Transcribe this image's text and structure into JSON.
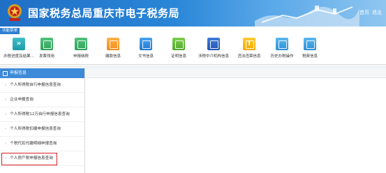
{
  "header": {
    "title": "国家税务总局重庆市电子税务局",
    "links": [
      "首页",
      "退出"
    ]
  },
  "function_bar_label": "功能菜单",
  "toolbar": [
    {
      "label": "办税进度及结果...",
      "icon": "fast-forward-icon",
      "color": "#1e9aa8"
    },
    {
      "label": "发票领用",
      "icon": "invoice-icon",
      "color": "#2f9f5a"
    },
    {
      "label": "申报纳税",
      "icon": "tax-filing-icon",
      "color": "#2f9f5a"
    },
    {
      "label": "缴款信息",
      "icon": "payment-icon",
      "color": "#f08a1c"
    },
    {
      "label": "文书信息",
      "icon": "document-icon",
      "color": "#1f78d1"
    },
    {
      "label": "证明信息",
      "icon": "certificate-icon",
      "color": "#4ea82a"
    },
    {
      "label": "涉税中介机构信息",
      "icon": "agency-icon",
      "color": "#2455b0"
    },
    {
      "label": "违法违章信息",
      "icon": "violation-icon",
      "color": "#f2a900"
    },
    {
      "label": "历史办税操作",
      "icon": "history-icon",
      "color": "#2b8fd6"
    },
    {
      "label": "税费信息",
      "icon": "tax-fee-icon",
      "color": "#2b8fd6"
    }
  ],
  "sidebar": {
    "header": "申报信息",
    "items": [
      "个人所得税自行申报信息查询",
      "企业申报查询",
      "个人所得税12万自行申报信息查询",
      "个人所得税扣缴申报信息查询",
      "个税代扣代缴明细申报查询",
      "个人房产税申报信息查询"
    ],
    "highlighted_index": 5
  },
  "colors": {
    "banner": "#2a86d8",
    "sidebar_header": "#3d8ad8",
    "highlight_border": "#d62020"
  }
}
